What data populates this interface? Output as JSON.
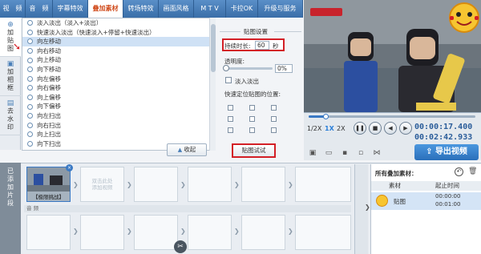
{
  "tabs": [
    {
      "label": "视　频"
    },
    {
      "label": "音　频"
    },
    {
      "label": "字幕特效"
    },
    {
      "label": "叠加素材"
    },
    {
      "label": "转场特效"
    },
    {
      "label": "画面风格"
    },
    {
      "label": "M T V"
    },
    {
      "label": "卡拉OK"
    },
    {
      "label": "升级与服务"
    }
  ],
  "side_tabs": [
    {
      "label": "加\n贴\n图",
      "icon": "sticker-icon"
    },
    {
      "label": "加\n相\n框",
      "icon": "frame-icon"
    },
    {
      "label": "去\n水\n印",
      "icon": "watermark-icon"
    }
  ],
  "effects": [
    "淡入淡出（淡入+淡出）",
    "快速淡入淡出（快速淡入+停留+快速淡出）",
    "向左移动",
    "向右移动",
    "向上移动",
    "向下移动",
    "向左偏移",
    "向右偏移",
    "向上偏移",
    "向下偏移",
    "向左扫出",
    "向右扫出",
    "向上扫出",
    "向下扫出"
  ],
  "selected_effect": "向左移动",
  "collapse_label": "收起",
  "settings": {
    "title": "贴图设置",
    "duration_label": "持续时长:",
    "duration_value": "60",
    "duration_unit": "秒",
    "opacity_label": "透明度:",
    "opacity_value": "0%",
    "fade_label": "淡入淡出",
    "quick_pos_label": "快速定位贴图的位置:"
  },
  "preview_button": "贴图试试",
  "player": {
    "speed_1": "1/2X",
    "speed_2": "1X",
    "speed_3": "2X",
    "time_current": "00:00:17.400",
    "time_total": "00:02:42.933",
    "export_label": "导出视频"
  },
  "timeline": {
    "label": "已\n添\n加\n片\n段",
    "clip_name": "【极限挑战】",
    "placeholder": "双击此处\n添加视频",
    "audio_label": "音 频"
  },
  "assets": {
    "title": "所有叠加素材：",
    "col_material": "素材",
    "col_time": "起止时间",
    "row_name": "贴图",
    "row_start": "00:00:00",
    "row_end": "00:01:00"
  },
  "colors": {
    "tab_bg": "#3a6ea8",
    "active_tab_text": "#d04b1c",
    "highlight_border": "#d31f26",
    "export_bg": "#2a6fba"
  }
}
